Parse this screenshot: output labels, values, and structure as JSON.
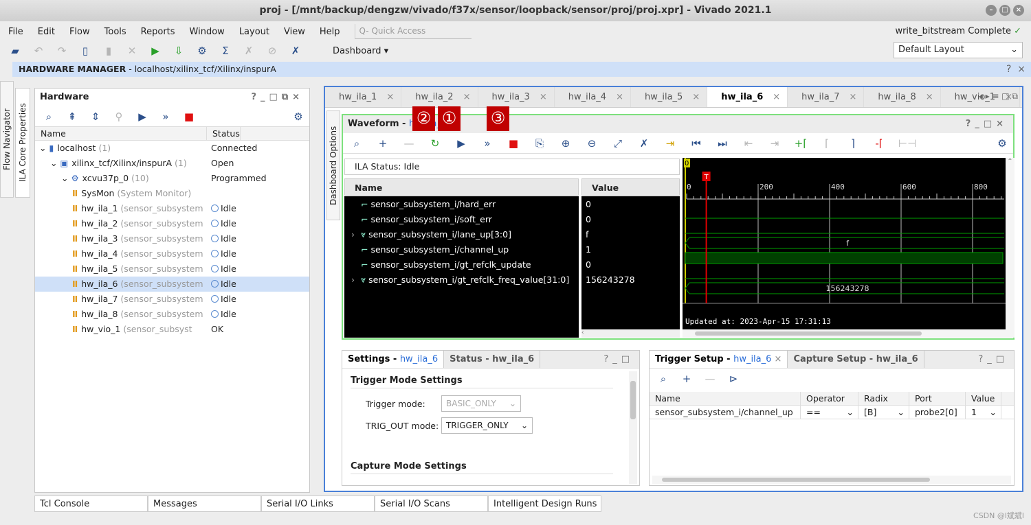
{
  "window": {
    "title": "proj - [/mnt/backup/dengzw/vivado/f37x/sensor/loopback/sensor/proj/proj.xpr] - Vivado 2021.1"
  },
  "menu": [
    "File",
    "Edit",
    "Flow",
    "Tools",
    "Reports",
    "Window",
    "Layout",
    "View",
    "Help"
  ],
  "quick_access": {
    "placeholder": "Q- Quick Access"
  },
  "toolbar": {
    "dashboard": "Dashboard ▾",
    "icons": [
      "open-project",
      "undo",
      "redo",
      "copy",
      "paste",
      "delete",
      "run",
      "program-device",
      "settings",
      "sum-report",
      "cancel",
      "clear",
      "disconnect"
    ]
  },
  "status": {
    "text": "write_bitstream Complete",
    "check": "✓"
  },
  "layout_select": "Default Layout",
  "hw_bar": {
    "title": "HARDWARE MANAGER",
    "path": " - localhost/xilinx_tcf/Xilinx/inspurA"
  },
  "side_tabs": [
    "Flow Navigator",
    "ILA Core Properties"
  ],
  "hardware": {
    "title": "Hardware",
    "columns": [
      "Name",
      "Status"
    ],
    "rows": [
      {
        "name": "localhost",
        "extra": " (1)",
        "status": "Connected",
        "level": 0,
        "icon": "server"
      },
      {
        "name": "xilinx_tcf/Xilinx/inspurA",
        "extra": " (1)",
        "status": "Open",
        "level": 1,
        "icon": "board"
      },
      {
        "name": "xcvu37p_0",
        "extra": " (10)",
        "status": "Programmed",
        "level": 2,
        "icon": "chip"
      },
      {
        "name": "SysMon",
        "extra": " (System Monitor)",
        "status": "",
        "level": 3,
        "icon": "ila"
      },
      {
        "name": "hw_ila_1",
        "extra": " (sensor_subsystem",
        "status": "Idle",
        "level": 3,
        "icon": "ila"
      },
      {
        "name": "hw_ila_2",
        "extra": " (sensor_subsystem",
        "status": "Idle",
        "level": 3,
        "icon": "ila"
      },
      {
        "name": "hw_ila_3",
        "extra": " (sensor_subsystem",
        "status": "Idle",
        "level": 3,
        "icon": "ila"
      },
      {
        "name": "hw_ila_4",
        "extra": " (sensor_subsystem",
        "status": "Idle",
        "level": 3,
        "icon": "ila"
      },
      {
        "name": "hw_ila_5",
        "extra": " (sensor_subsystem",
        "status": "Idle",
        "level": 3,
        "icon": "ila"
      },
      {
        "name": "hw_ila_6",
        "extra": " (sensor_subsystem",
        "status": "Idle",
        "level": 3,
        "icon": "ila",
        "selected": true
      },
      {
        "name": "hw_ila_7",
        "extra": " (sensor_subsystem",
        "status": "Idle",
        "level": 3,
        "icon": "ila"
      },
      {
        "name": "hw_ila_8",
        "extra": " (sensor_subsystem",
        "status": "Idle",
        "level": 3,
        "icon": "ila"
      },
      {
        "name": "hw_vio_1",
        "extra": " (sensor_subsyst",
        "status": "OK",
        "level": 3,
        "icon": "ila"
      }
    ]
  },
  "main_tabs": [
    "hw_ila_1",
    "hw_ila_2",
    "hw_ila_3",
    "hw_ila_4",
    "hw_ila_5",
    "hw_ila_6",
    "hw_ila_7",
    "hw_ila_8",
    "hw_vio_1"
  ],
  "active_tab": "hw_ila_6",
  "dashboard_options": "Dashboard Options",
  "waveform": {
    "title": "Waveform - ",
    "title_link": "hw_ila_6",
    "annotations": [
      "②",
      "①",
      "③"
    ],
    "ila_status": "ILA Status: Idle",
    "columns": [
      "Name",
      "Value"
    ],
    "signals": [
      {
        "name": "sensor_subsystem_i/hard_err",
        "value": "0",
        "bus": false
      },
      {
        "name": "sensor_subsystem_i/soft_err",
        "value": "0",
        "bus": false
      },
      {
        "name": "sensor_subsystem_i/lane_up[3:0]",
        "value": "f",
        "bus": true
      },
      {
        "name": "sensor_subsystem_i/channel_up",
        "value": "1",
        "bus": false
      },
      {
        "name": "sensor_subsystem_i/gt_refclk_update",
        "value": "0",
        "bus": false
      },
      {
        "name": "sensor_subsystem_i/gt_refclk_freq_value[31:0]",
        "value": "156243278",
        "bus": true
      }
    ],
    "time_ticks": [
      "0",
      "200",
      "400",
      "600",
      "800"
    ],
    "origin_marker": "0",
    "trigger_marker": "T",
    "trigger_sample": 55,
    "updated": "Updated at: 2023-Apr-15 17:31:13",
    "colors": {
      "wave": "#00a000",
      "trigger": "#e00000",
      "bg": "#000000"
    }
  },
  "settings": {
    "tabs": [
      {
        "label": "Settings - ",
        "link": "hw_ila_6"
      },
      {
        "label": "Status - hw_ila_6"
      }
    ],
    "trigger_section": "Trigger Mode Settings",
    "trigger_mode_label": "Trigger mode:",
    "trigger_mode": "BASIC_ONLY",
    "trig_out_label": "TRIG_OUT mode:",
    "trig_out": "TRIGGER_ONLY",
    "capture_section": "Capture Mode Settings"
  },
  "trigger": {
    "tabs": [
      {
        "label": "Trigger Setup - ",
        "link": "hw_ila_6"
      },
      {
        "label": "Capture Setup - hw_ila_6"
      }
    ],
    "columns": [
      "Name",
      "Operator",
      "Radix",
      "Port",
      "Value"
    ],
    "row": {
      "name": "sensor_subsystem_i/channel_up",
      "operator": "==",
      "radix": "[B]",
      "port": "probe2[0]",
      "value": "1"
    }
  },
  "bottom_tabs": [
    "Tcl Console",
    "Messages",
    "Serial I/O Links",
    "Serial I/O Scans",
    "Intelligent Design Runs"
  ],
  "watermark": "CSDN @l斌斌l"
}
